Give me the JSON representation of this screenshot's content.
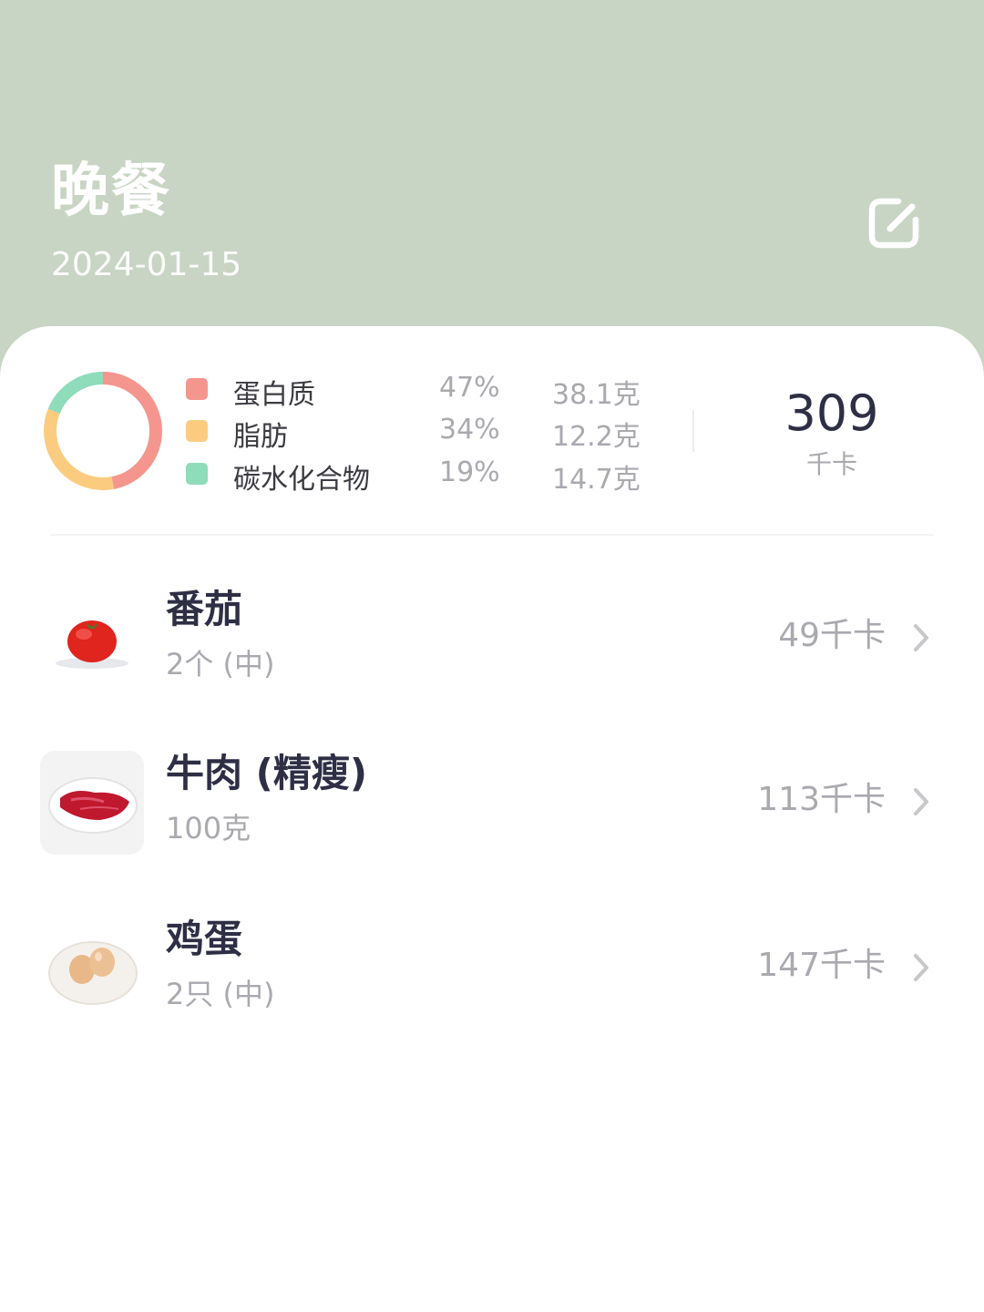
{
  "header": {
    "title": "晚餐",
    "date": "2024-01-15"
  },
  "summary": {
    "macros": [
      {
        "name": "蛋白质",
        "percent": "47%",
        "grams": "38.1克",
        "color": "#f4968e"
      },
      {
        "name": "脂肪",
        "percent": "34%",
        "grams": "12.2克",
        "color": "#fbcc80"
      },
      {
        "name": "碳水化合物",
        "percent": "19%",
        "grams": "14.7克",
        "color": "#8fdcba"
      }
    ],
    "total_kcal": "309",
    "kcal_unit": "千卡"
  },
  "chart_data": {
    "type": "pie",
    "categories": [
      "蛋白质",
      "脂肪",
      "碳水化合物"
    ],
    "values": [
      47,
      34,
      19
    ],
    "colors": [
      "#f4968e",
      "#fbcc80",
      "#8fdcba"
    ]
  },
  "foods": [
    {
      "name": "番茄",
      "amount": "2个 (中)",
      "kcal": "49千卡",
      "icon": "tomato-image"
    },
    {
      "name": "牛肉 (精瘦)",
      "amount": "100克",
      "kcal": "113千卡",
      "icon": "beef-image"
    },
    {
      "name": "鸡蛋",
      "amount": "2只 (中)",
      "kcal": "147千卡",
      "icon": "eggs-image"
    }
  ],
  "colors": {
    "header_bg": "#c9d5c4",
    "primary_text": "#2e2f45",
    "secondary_text": "#a9a9b0"
  }
}
